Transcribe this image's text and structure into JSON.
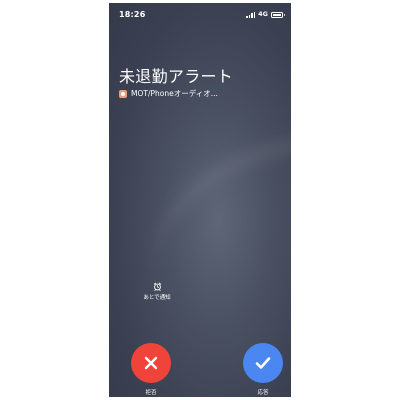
{
  "status_bar": {
    "time": "18:26",
    "network": "4G",
    "icons": [
      "signal-icon",
      "battery-icon"
    ]
  },
  "call": {
    "title": "未退勤アラート",
    "source_app_icon": "app-icon",
    "source_text": "MOT/Phoneオーディオ..."
  },
  "snooze": {
    "icon": "alarm-clock-icon",
    "label": "あとで通知"
  },
  "actions": {
    "decline": {
      "icon": "close-icon",
      "label": "拒否",
      "color": "#f0443a"
    },
    "accept": {
      "icon": "check-icon",
      "label": "応答",
      "color": "#4b87f0"
    }
  }
}
